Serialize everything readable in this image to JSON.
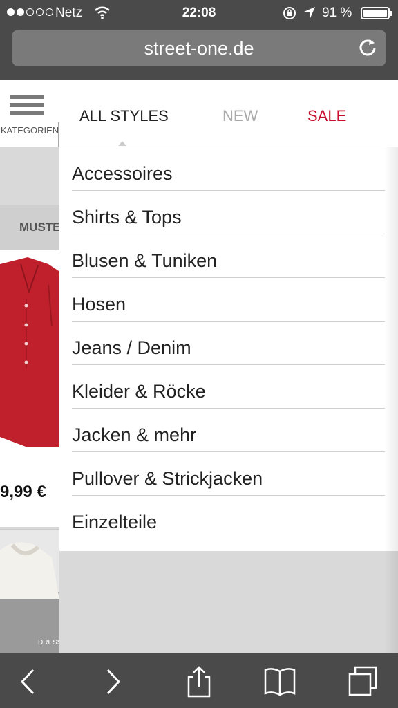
{
  "status_bar": {
    "carrier": "Netz",
    "time": "22:08",
    "battery_percent": "91 %",
    "battery_level": 0.91,
    "signal_bars_filled": 2,
    "signal_bars_total": 5
  },
  "address_bar": {
    "url": "street-one.de"
  },
  "header": {
    "categories_label": "KATEGORIEN",
    "tabs": [
      {
        "label": "ALL STYLES",
        "state": "active"
      },
      {
        "label": "NEW",
        "state": "inactive"
      },
      {
        "label": "SALE",
        "state": "sale"
      }
    ]
  },
  "background_page": {
    "filter_label": "MUSTE",
    "product_price": "9,99 €",
    "product_label": "DRESS"
  },
  "menu": {
    "items": [
      "Accessoires",
      "Shirts & Tops",
      "Blusen & Tuniken",
      "Hosen",
      "Jeans / Denim",
      "Kleider & Röcke",
      "Jacken & mehr",
      "Pullover & Strickjacken",
      "Einzelteile"
    ]
  },
  "colors": {
    "chrome": "#4a4a4a",
    "sale": "#c8102e",
    "product_red": "#c0202c"
  }
}
